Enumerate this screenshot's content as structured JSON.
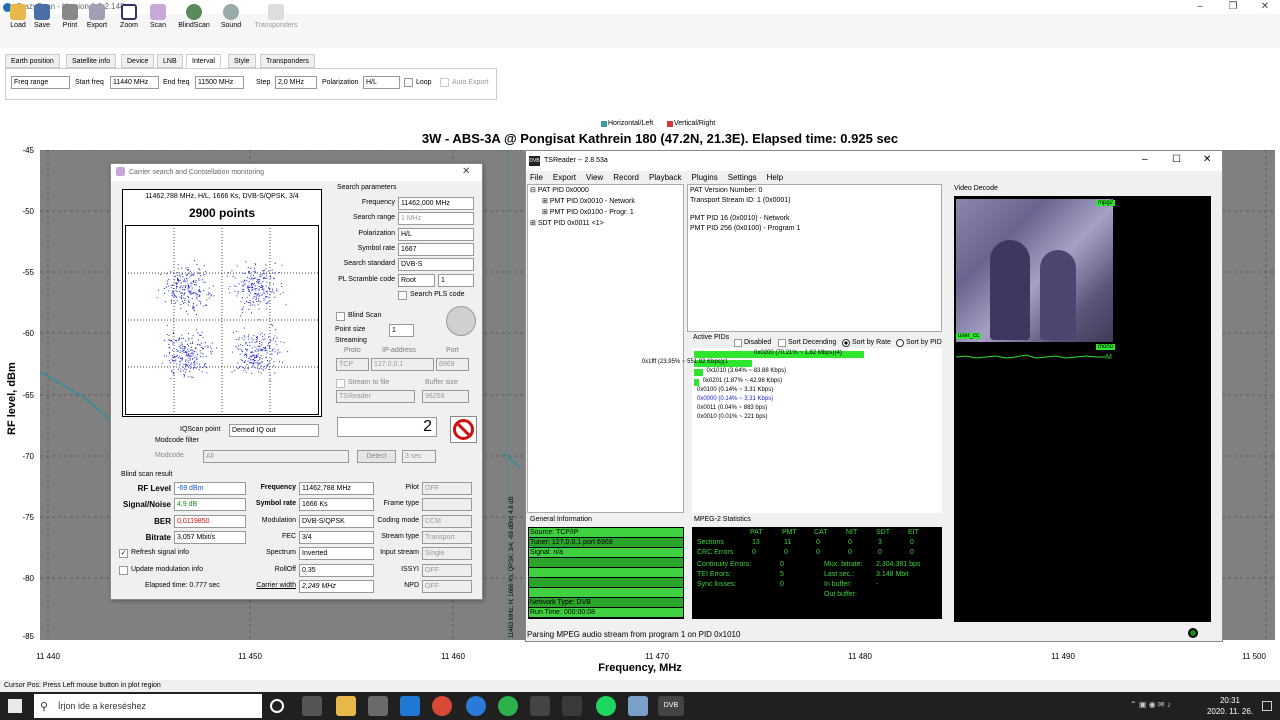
{
  "app": {
    "title": "CrazyScan - Version 1.0.2.148"
  },
  "toolbar": [
    {
      "label": "Load"
    },
    {
      "label": "Save"
    },
    {
      "label": "Print"
    },
    {
      "label": "Export"
    },
    {
      "label": "Zoom"
    },
    {
      "label": "Scan"
    },
    {
      "label": "BlindScan"
    },
    {
      "label": "Sound"
    },
    {
      "label": "Transponders"
    }
  ],
  "tabs": [
    "Earth position",
    "Satellite info",
    "Device",
    "LNB",
    "Interval",
    "Style",
    "Transponders"
  ],
  "interval": {
    "mode": "Freq range",
    "start_label": "Start freq",
    "start": "11440 MHz",
    "end_label": "End freq",
    "end": "11500 MHz",
    "step_label": "Step",
    "step": "2,0 MHz",
    "pol_label": "Polarization",
    "pol": "H/L",
    "loop": "Loop",
    "auto_export": "Auto Export"
  },
  "legend": {
    "h": "Horizontal/Left",
    "v": "Vertical/Right"
  },
  "plot": {
    "title": "3W - ABS-3A @ Pongisat  Kathrein 180 (47.2N, 21.3E). Elapsed time: 0.925 sec",
    "ylabel": "RF level, dBm",
    "xlabel": "Frequency, MHz",
    "yticks": [
      "-45",
      "-50",
      "-55",
      "-60",
      "-65",
      "-70",
      "-75",
      "-80",
      "-85"
    ],
    "xticks": [
      "11 440",
      "11 450",
      "11 460",
      "11 470",
      "11 480",
      "11 490",
      "11 500"
    ],
    "vlabel": "11463 MHz; H; 1666 Ks; QPSK; 3/4; -69 dBm; 4.8 dB"
  },
  "carrier": {
    "title": "Carrier search and Constellation monitoring",
    "const_info": "11462,788 MHz, H/L, 1666 Ks, DVB-S/QPSK, 3/4",
    "points": "2900 points",
    "sp_title": "Search parameters",
    "sp": [
      {
        "label": "Frequency",
        "value": "11462,000 MHz"
      },
      {
        "label": "Search range",
        "value": "1 MHz"
      },
      {
        "label": "Polarization",
        "value": "H/L"
      },
      {
        "label": "Symbol rate",
        "value": "1667"
      },
      {
        "label": "Search standard",
        "value": "DVB-S"
      },
      {
        "label": "PL Scramble code",
        "value": "Root"
      }
    ],
    "pl_num": "1",
    "search_pls": "Search PLS code",
    "blind_scan": "Blind Scan",
    "point_size_label": "Point size",
    "point_size": "1",
    "streaming": "Streaming",
    "proto": "Proto",
    "ip_label": "IP-address",
    "port_label": "Port",
    "proto_val": "TCP",
    "ip_val": "127.0.0.1",
    "port_val": "6969",
    "stream_to_file": "Stream to file",
    "buffer_label": "Buffer size",
    "target": "TSReader",
    "buffer": "96256",
    "iq_label": "IQScan point",
    "iq_val": "Demod IQ out",
    "modcode_filter": "Modcode filter",
    "modcode_label": "Modcode",
    "modcode_val": "All",
    "detect": "Detect",
    "sec": "3 sec",
    "bsr_title": "Blind scan result",
    "rf_label": "RF Level",
    "rf_val": "-69 dBm",
    "sn_label": "Signal/Noise",
    "sn_val": "4,9 dB",
    "ber_label": "BER",
    "ber_val": "0,0119850",
    "bitrate_label": "Bitrate",
    "bitrate_val": "3,057 Mbit/s",
    "freq_label": "Frequency",
    "freq_val": "11462,788 MHz",
    "sr_label": "Symbol rate",
    "sr_val": "1666 Ks",
    "mod_label": "Modulation",
    "mod_val": "DVB-S/QPSK",
    "fec_label": "FEC",
    "fec_val": "3/4",
    "spec_label": "Spectrum",
    "spec_val": "Inverted",
    "roll_label": "RollOff",
    "roll_val": "0.35",
    "cw_label": "Carrier width",
    "cw_val": "2,249 MHz",
    "pilot_label": "Pilot",
    "pilot_val": "OFF",
    "frame_label": "Frame type",
    "coding_label": "Coding mode",
    "coding_val": "CCM",
    "st_label": "Stream type",
    "st_val": "Transport",
    "is_label": "Input stream",
    "is_val": "Single",
    "issyi_label": "ISSYI",
    "issyi_val": "OFF",
    "npd_label": "NPD",
    "npd_val": "OFF",
    "refresh": "Refresh signal info",
    "update_mod": "Update modulation info",
    "elapsed": "Elapsed time: 0.777 sec",
    "counter": "2"
  },
  "tsreader": {
    "title": "TSReader -- 2.8.53a",
    "menu": [
      "File",
      "Export",
      "View",
      "Record",
      "Playback",
      "Plugins",
      "Settings",
      "Help"
    ],
    "tree": [
      "PAT PID 0x0000",
      "PMT PID 0x0010 - Network",
      "PMT PID 0x0100 - Progr. 1",
      "SDT PID 0x0011 <1>"
    ],
    "info": [
      "PAT Version Number: 0",
      "Transport Stream ID: 1 (0x0001)",
      "",
      "PMT PID 16 (0x0010) - Network",
      "PMT PID 256 (0x0100) - Program 1"
    ],
    "active_pids": "Active PIDs",
    "disabled": "Disabled",
    "sort_desc": "Sort Decending",
    "sort_rate": "Sort by Rate",
    "sort_pid": "Sort by PID",
    "pids": [
      {
        "text": "0x0200 (70.21% ~ 1.82 Mbps)(4)",
        "frac": 1.0
      },
      {
        "text": "0x1fff (23.95% ~ 551.82 Kbps)(1",
        "frac": 0.34
      },
      {
        "text": "0x1010 (3.64% ~ 83.88 Kbps)",
        "frac": 0.05
      },
      {
        "text": "0x0201 (1.87% ~ 42.98 Kbps)",
        "frac": 0.027
      },
      {
        "text": "0x0100 (0.14% ~ 3.31 Kbps)",
        "frac": 0
      },
      {
        "text": "0x0000 (0.14% ~ 3.31 Kbps)",
        "frac": 0
      },
      {
        "text": "0x0011 (0.04% ~ 883 bps)",
        "frac": 0
      },
      {
        "text": "0x0010 (0.01% ~ 221 bps)",
        "frac": 0
      }
    ],
    "video_decode": "Video Decode",
    "mpeg2_tag": "mpg2",
    "user_cc": "user_cc",
    "mono": "mono",
    "m": "M",
    "gen_info_title": "General Information",
    "gen_info": [
      "Source: TCP/IP",
      "Tuner: 127.0.0.1 port 6969",
      "Signal: n/a",
      "",
      "",
      "",
      "",
      "Network Type: DVB",
      "Run Time: 000:00:08"
    ],
    "mpeg_title": "MPEG-2 Statistics",
    "mpeg_headers": [
      "PAT",
      "PMT",
      "CAT",
      "NIT",
      "SDT",
      "EIT"
    ],
    "mpeg_rows": [
      {
        "label": "Sections",
        "vals": [
          "13",
          "11",
          "0",
          "0",
          "3",
          "0"
        ]
      },
      {
        "label": "CRC Errors",
        "vals": [
          "0",
          "0",
          "0",
          "0",
          "0",
          "0"
        ]
      }
    ],
    "stats_left": [
      {
        "label": "Continuity Errors:",
        "val": "0"
      },
      {
        "label": "TEI Errors:",
        "val": "5"
      },
      {
        "label": "Sync losses:",
        "val": "0"
      }
    ],
    "stats_right": [
      {
        "label": "Mux. bitrate:",
        "val": "2,304,381 bps"
      },
      {
        "label": "Last sec.:",
        "val": "3.148 Mbit"
      },
      {
        "label": "In buffer:",
        "val": "-"
      },
      {
        "label": "Out buffer:",
        "val": ""
      }
    ],
    "status": "Parsing MPEG audio stream from program 1 on PID 0x1010"
  },
  "statusbar": "Cursor Pos: Press Left mouse button in plot region",
  "taskbar": {
    "search": "Írjon ide a kereséshez",
    "time": "20:31",
    "date": "2020. 11. 26."
  }
}
